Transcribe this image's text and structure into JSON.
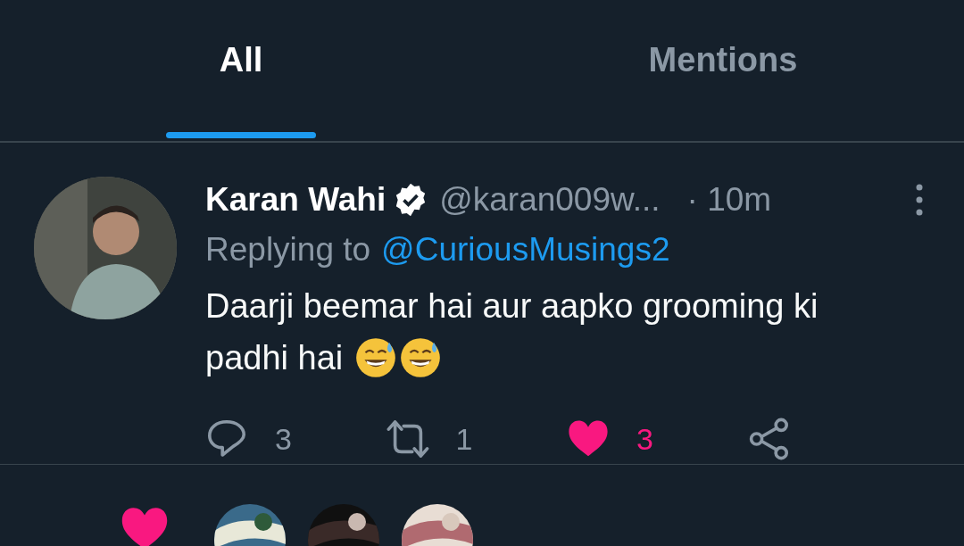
{
  "tabs": [
    {
      "label": "All",
      "selected": true
    },
    {
      "label": "Mentions",
      "selected": false
    }
  ],
  "tweet": {
    "name": "Karan Wahi",
    "verified": true,
    "handle": "@karan009w...",
    "time": "· 10m",
    "replying_label": "Replying to",
    "replying_to": "@CuriousMusings2",
    "text_lines": [
      "Daarji beemar hai aur aapko grooming ki",
      "padhi hai"
    ],
    "actions": [
      {
        "kind": "reply",
        "count": "3",
        "selected": false
      },
      {
        "kind": "retweet",
        "count": "1",
        "selected": false
      },
      {
        "kind": "like",
        "count": "3",
        "selected": true
      },
      {
        "kind": "share"
      }
    ]
  },
  "next_notification": {
    "kind": "like"
  }
}
